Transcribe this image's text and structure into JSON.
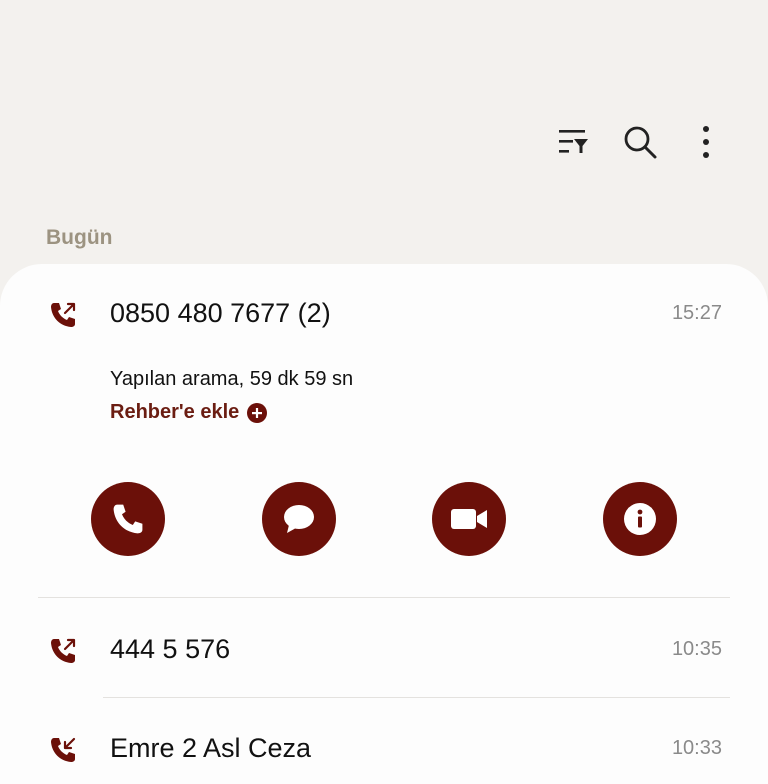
{
  "toolbar": {
    "filter_icon": "filter-list-icon",
    "search_icon": "search-icon",
    "more_icon": "more-vertical-icon"
  },
  "section": {
    "label": "Bugün"
  },
  "calls": [
    {
      "name": "0850 480 7677 (2)",
      "time": "15:27",
      "direction": "outgoing",
      "detail": "Yapılan arama, 59 dk 59 sn",
      "add_contact_label": "Rehber'e ekle"
    },
    {
      "name": "444 5 576",
      "time": "10:35",
      "direction": "outgoing"
    },
    {
      "name": "Emre 2 Asl Ceza",
      "time": "10:33",
      "direction": "incoming"
    }
  ],
  "actions": [
    "phone-icon",
    "message-icon",
    "video-call-icon",
    "info-icon"
  ],
  "colors": {
    "accent": "#6b1009",
    "link": "#6b1d12",
    "section_label": "#9c9381",
    "background": "#f3f1ee",
    "card": "#fdfdfd",
    "time": "#8a8a8a"
  }
}
